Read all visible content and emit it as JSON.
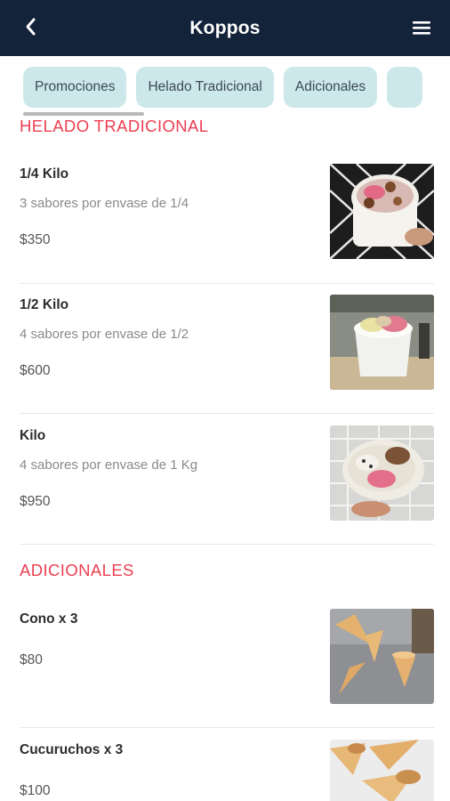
{
  "header": {
    "title": "Koppos",
    "back_icon": "chevron-left-icon",
    "menu_icon": "hamburger-menu-icon"
  },
  "tabs": [
    {
      "label": "Promociones",
      "selected": true
    },
    {
      "label": "Helado Tradicional"
    },
    {
      "label": "Adicionales"
    }
  ],
  "colors": {
    "header_bg": "#13233a",
    "tab_bg": "#cce8ea",
    "section_title": "#ec3f52"
  },
  "sections": [
    {
      "title": "HELADO TRADICIONAL",
      "items": [
        {
          "name": "1/4 Kilo",
          "description": "3 sabores por envase de 1/4",
          "price": "$350",
          "image": "ice-cream-quarter-kilo-photo"
        },
        {
          "name": "1/2 Kilo",
          "description": "4 sabores por envase de 1/2",
          "price": "$600",
          "image": "ice-cream-half-kilo-photo"
        },
        {
          "name": "Kilo",
          "description": "4 sabores por envase de 1 Kg",
          "price": "$950",
          "image": "ice-cream-kilo-photo"
        }
      ]
    },
    {
      "title": "ADICIONALES",
      "items": [
        {
          "name": "Cono x 3",
          "price": "$80",
          "image": "cones-photo"
        },
        {
          "name": "Cucuruchos x 3",
          "price": "$100",
          "image": "cucuruchos-photo"
        }
      ]
    }
  ]
}
